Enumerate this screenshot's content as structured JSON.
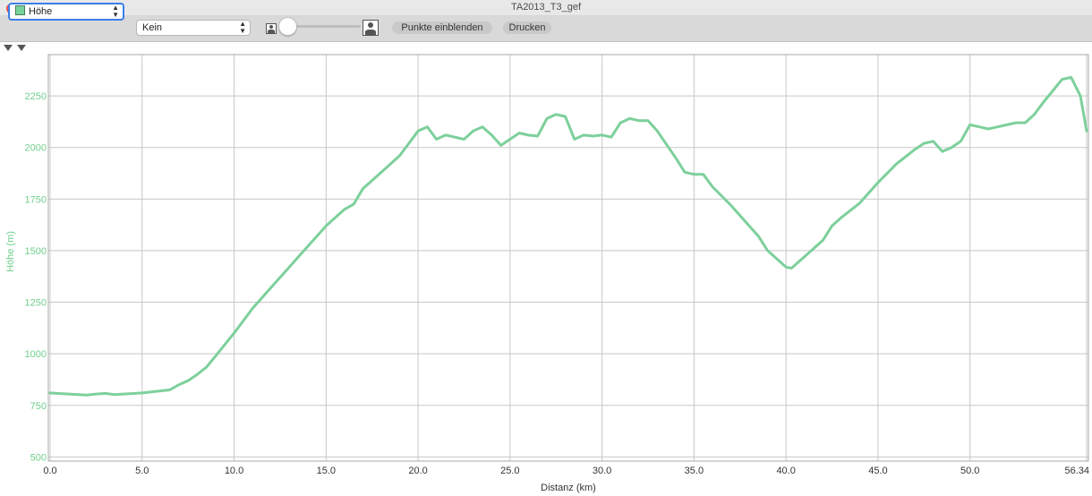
{
  "window": {
    "title": "TA2013_T3_gef"
  },
  "toolbar": {
    "series_select": {
      "value": "Höhe",
      "swatch_color": "#78d39a"
    },
    "second_select": {
      "value": "Kein"
    },
    "zoom_slider": {
      "value": 0
    },
    "show_points_label": "Punkte einblenden",
    "print_label": "Drucken"
  },
  "colors": {
    "line": "#7dd09b",
    "axis_label": "#6fcf8c",
    "grid": "#c8c8c8"
  },
  "chart_data": {
    "type": "line",
    "xlabel": "Distanz (km)",
    "ylabel": "Höhe (m)",
    "xlim": [
      0,
      56.34
    ],
    "ylim": [
      480,
      2450
    ],
    "x_ticks": [
      "0.0",
      "5.0",
      "10.0",
      "15.0",
      "20.0",
      "25.0",
      "30.0",
      "35.0",
      "40.0",
      "45.0",
      "50.0",
      "56.34"
    ],
    "x_tick_values": [
      0,
      5,
      10,
      15,
      20,
      25,
      30,
      35,
      40,
      45,
      50,
      56.34
    ],
    "y_ticks": [
      500,
      750,
      1000,
      1250,
      1500,
      1750,
      2000,
      2250
    ],
    "grid": true,
    "series": [
      {
        "x": [
          0,
          1,
          2,
          2.5,
          3,
          3.5,
          4,
          5,
          6,
          6.5,
          7,
          7.5,
          8,
          8.5,
          9,
          10,
          11,
          11.5,
          12,
          12.5,
          13,
          13.5,
          14,
          15,
          16,
          16.5,
          17,
          17.5,
          18,
          19,
          19.5,
          20,
          20.5,
          21,
          21.5,
          22,
          22.5,
          23,
          23.5,
          24,
          24.5,
          25,
          25.5,
          26,
          26.5,
          27,
          27.5,
          28,
          28.5,
          29,
          29.5,
          30,
          30.5,
          31,
          31.5,
          32,
          32.5,
          33,
          34,
          34.5,
          35,
          35.5,
          36,
          37,
          38,
          38.5,
          39,
          40,
          40.3,
          41,
          41.5,
          42,
          42.5,
          43,
          44,
          45,
          46,
          47,
          47.5,
          48,
          48.5,
          49,
          49.5,
          50,
          50.5,
          51,
          51.5,
          52,
          52.5,
          53,
          53.5,
          54,
          55,
          55.5,
          56,
          56.34
        ],
        "y": [
          810,
          805,
          800,
          805,
          808,
          802,
          805,
          810,
          820,
          825,
          850,
          870,
          900,
          935,
          990,
          1100,
          1220,
          1270,
          1320,
          1370,
          1420,
          1470,
          1520,
          1620,
          1700,
          1725,
          1800,
          1840,
          1880,
          1960,
          2020,
          2080,
          2100,
          2040,
          2060,
          2050,
          2040,
          2080,
          2100,
          2060,
          2010,
          2040,
          2070,
          2060,
          2055,
          2140,
          2160,
          2150,
          2040,
          2060,
          2055,
          2060,
          2050,
          2120,
          2140,
          2130,
          2130,
          2080,
          1950,
          1880,
          1870,
          1870,
          1810,
          1720,
          1620,
          1570,
          1500,
          1420,
          1415,
          1470,
          1510,
          1550,
          1620,
          1660,
          1730,
          1830,
          1920,
          1990,
          2020,
          2030,
          1980,
          2000,
          2030,
          2110,
          2100,
          2090,
          2100,
          2110,
          2120,
          2120,
          2160,
          2220,
          2330,
          2340,
          2250,
          2080
        ]
      }
    ]
  }
}
